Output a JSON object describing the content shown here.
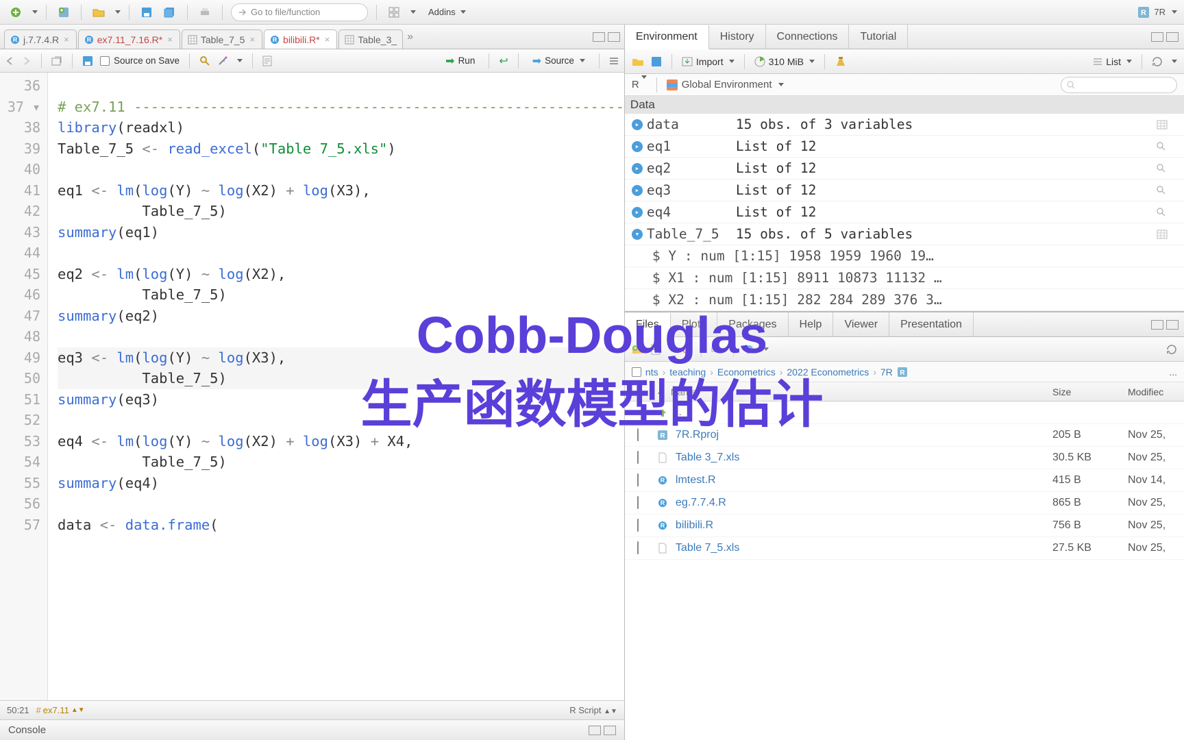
{
  "overlay": {
    "line1": "Cobb-Douglas",
    "line2": "生产函数模型的估计"
  },
  "top": {
    "goto": "Go to file/function",
    "addins": "Addins",
    "project": "7R"
  },
  "editor_tabs": [
    {
      "label": "j.7.7.4.R",
      "icon": "r-doc",
      "closable": true,
      "active": false
    },
    {
      "label": "ex7.11_7.16.R*",
      "icon": "r-doc",
      "closable": true,
      "active": false,
      "modified": true
    },
    {
      "label": "Table_7_5",
      "icon": "table",
      "closable": true,
      "active": false
    },
    {
      "label": "bilibili.R*",
      "icon": "r-doc",
      "closable": true,
      "active": true,
      "modified": true
    },
    {
      "label": "Table_3_",
      "icon": "table",
      "closable": false,
      "active": false
    }
  ],
  "editor_toolbar": {
    "source_on_save": "Source on Save",
    "run": "Run",
    "source": "Source"
  },
  "code_lines": [
    {
      "n": 36,
      "html": ""
    },
    {
      "n": 37,
      "fold": true,
      "html": "<span class='comment'># ex7.11 ----------------------------------------------------------</span>"
    },
    {
      "n": 38,
      "html": "<span class='kw'>library</span>(readxl)"
    },
    {
      "n": 39,
      "html": "Table_7_5 <span class='op'>&lt;-</span> <span class='kw'>read_excel</span>(<span class='str'>\"Table 7_5.xls\"</span>)"
    },
    {
      "n": 40,
      "html": ""
    },
    {
      "n": 41,
      "html": "eq1 <span class='op'>&lt;-</span> <span class='kw'>lm</span>(<span class='kw'>log</span>(Y) <span class='op'>~</span> <span class='kw'>log</span>(X2) <span class='op'>+</span> <span class='kw'>log</span>(X3),"
    },
    {
      "n": 42,
      "html": "          Table_7_5)"
    },
    {
      "n": 43,
      "html": "<span class='kw'>summary</span>(eq1)"
    },
    {
      "n": 44,
      "html": ""
    },
    {
      "n": 45,
      "html": "eq2 <span class='op'>&lt;-</span> <span class='kw'>lm</span>(<span class='kw'>log</span>(Y) <span class='op'>~</span> <span class='kw'>log</span>(X2),"
    },
    {
      "n": 46,
      "html": "          Table_7_5)"
    },
    {
      "n": 47,
      "html": "<span class='kw'>summary</span>(eq2)"
    },
    {
      "n": 48,
      "html": ""
    },
    {
      "n": 49,
      "hl": true,
      "html": "eq3 <span class='op'>&lt;-</span> <span class='kw'>lm</span>(<span class='kw'>log</span>(Y) <span class='op'>~</span> <span class='kw'>log</span>(X3),"
    },
    {
      "n": 50,
      "hl": true,
      "html": "          Table_7_5)"
    },
    {
      "n": 51,
      "html": "<span class='kw'>summary</span>(eq3)"
    },
    {
      "n": 52,
      "html": ""
    },
    {
      "n": 53,
      "html": "eq4 <span class='op'>&lt;-</span> <span class='kw'>lm</span>(<span class='kw'>log</span>(Y) <span class='op'>~</span> <span class='kw'>log</span>(X2) <span class='op'>+</span> <span class='kw'>log</span>(X3) <span class='op'>+</span> X4,"
    },
    {
      "n": 54,
      "html": "          Table_7_5)"
    },
    {
      "n": 55,
      "html": "<span class='kw'>summary</span>(eq4)"
    },
    {
      "n": 56,
      "html": ""
    },
    {
      "n": 57,
      "html": "data <span class='op'>&lt;-</span> <span class='kw'>data.frame</span>("
    }
  ],
  "statusbar": {
    "pos": "50:21",
    "fn": "ex7.11",
    "type": "R Script"
  },
  "console": {
    "label": "Console"
  },
  "env_tabs": [
    "Environment",
    "History",
    "Connections",
    "Tutorial"
  ],
  "env_toolbar": {
    "import": "Import",
    "mem": "310 MiB",
    "view": "List"
  },
  "env_scope": {
    "lang": "R",
    "scope": "Global Environment"
  },
  "env": {
    "header": "Data",
    "rows": [
      {
        "name": "data",
        "val": "15 obs. of 3 variables",
        "icon": "expand",
        "action": "table"
      },
      {
        "name": "eq1",
        "val": "List of  12",
        "icon": "expand",
        "action": "search"
      },
      {
        "name": "eq2",
        "val": "List of  12",
        "icon": "expand",
        "action": "search"
      },
      {
        "name": "eq3",
        "val": "List of  12",
        "icon": "expand",
        "action": "search"
      },
      {
        "name": "eq4",
        "val": "List of  12",
        "icon": "expand",
        "action": "search"
      },
      {
        "name": "Table_7_5",
        "val": "15 obs. of 5 variables",
        "icon": "collapse",
        "action": "table"
      }
    ],
    "detail_rows": [
      "  $ Y  : num [1:15] 1958 1959 1960 19…",
      "  $ X1 : num [1:15] 8911 10873 11132 …",
      "  $ X2 : num [1:15] 282 284 289 376 3…"
    ]
  },
  "files_tabs": [
    "Files",
    "Plots",
    "Packages",
    "Help",
    "Viewer",
    "Presentation"
  ],
  "breadcrumb": [
    "nts",
    "teaching",
    "Econometrics",
    "2022 Econometrics",
    "7R"
  ],
  "file_headers": {
    "name": "Name",
    "size": "Size",
    "modified": "Modifiec"
  },
  "files": [
    {
      "up": true,
      "name": ".."
    },
    {
      "icon": "rproj",
      "name": "7R.Rproj",
      "size": "205 B",
      "mod": "Nov 25,"
    },
    {
      "icon": "file",
      "name": "Table 3_7.xls",
      "size": "30.5 KB",
      "mod": "Nov 25,"
    },
    {
      "icon": "r",
      "name": "lmtest.R",
      "size": "415 B",
      "mod": "Nov 14,"
    },
    {
      "icon": "r",
      "name": "eg.7.7.4.R",
      "size": "865 B",
      "mod": "Nov 25,"
    },
    {
      "icon": "r",
      "name": "bilibili.R",
      "size": "756 B",
      "mod": "Nov 25,"
    },
    {
      "icon": "file",
      "name": "Table 7_5.xls",
      "size": "27.5 KB",
      "mod": "Nov 25,"
    }
  ]
}
